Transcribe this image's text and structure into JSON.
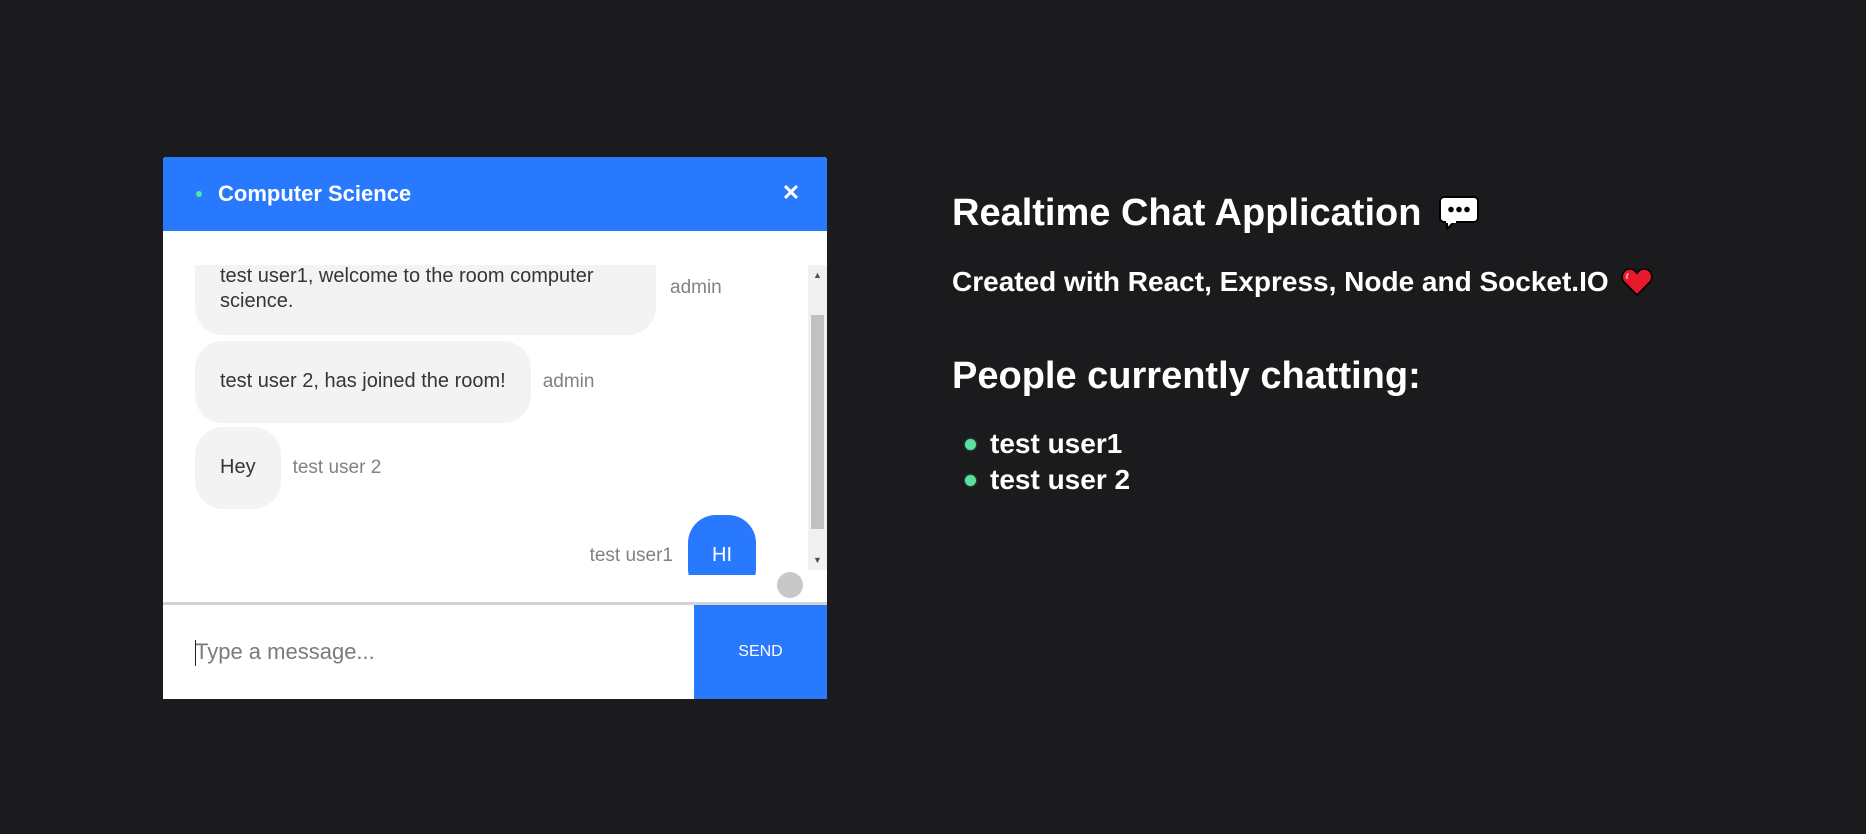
{
  "colors": {
    "background": "#1b1b1d",
    "accent": "#2979ff",
    "online": "#4ee8a6",
    "bubble_gray": "#f3f3f3"
  },
  "chat": {
    "room_name": "Computer Science",
    "close_icon": "close-icon",
    "messages": [
      {
        "text_line1": "test user1, welcome to the room computer",
        "text_line2": "science.",
        "sender": "admin",
        "own": false
      },
      {
        "text": "test user 2, has joined the room!",
        "sender": "admin",
        "own": false
      },
      {
        "text": "Hey",
        "sender": "test user 2",
        "own": false
      },
      {
        "text": "HI",
        "sender": "test user1",
        "own": true
      }
    ],
    "input": {
      "value": "",
      "placeholder": "Type a message..."
    },
    "send_label": "SEND"
  },
  "info": {
    "title": "Realtime Chat Application",
    "title_icon": "speech-bubble-icon",
    "subtitle": "Created with React, Express, Node and Socket.IO",
    "subtitle_icon": "heart-icon",
    "people_heading": "People currently chatting:",
    "people": [
      "test user1",
      "test user 2"
    ]
  }
}
